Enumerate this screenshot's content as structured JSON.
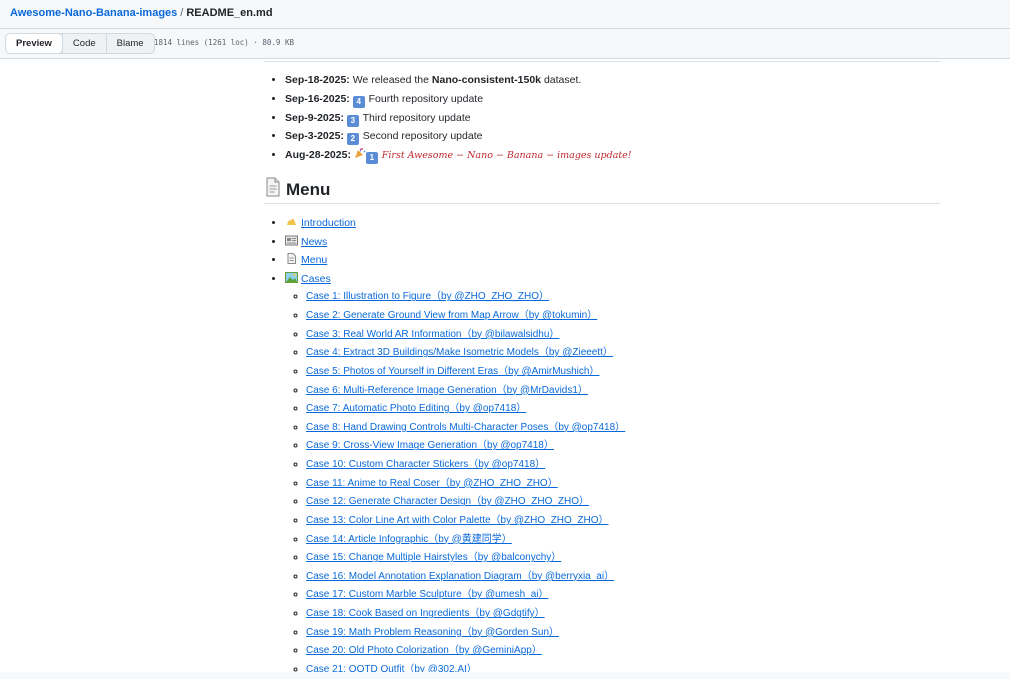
{
  "breadcrumb": {
    "repo": "Awesome-Nano-Banana-images",
    "separator": "/",
    "file": "README_en.md"
  },
  "toolbar": {
    "tabs": [
      {
        "label": "Preview",
        "active": true
      },
      {
        "label": "Code",
        "active": false
      },
      {
        "label": "Blame",
        "active": false
      }
    ],
    "file_info": "1814 lines (1261 loc) · 80.9 KB"
  },
  "news": [
    {
      "date": "Sep-18-2025:",
      "pre": " We released the ",
      "bold": "Nano-consistent-150k",
      "post": " dataset."
    },
    {
      "date": "Sep-16-2025:",
      "badge": "4",
      "text": "Fourth repository update"
    },
    {
      "date": "Sep-9-2025:",
      "badge": "3",
      "text": "Third repository update"
    },
    {
      "date": "Sep-3-2025:",
      "badge": "2",
      "text": "Second repository update"
    },
    {
      "date": "Aug-28-2025:",
      "badge": "1",
      "red_text": "First Awesome − Nano − Banana − images update!"
    }
  ],
  "menu": {
    "heading": "Menu",
    "items": [
      {
        "label": "Introduction",
        "icon": "wave-icon"
      },
      {
        "label": "News",
        "icon": "newspaper-icon"
      },
      {
        "label": "Menu",
        "icon": "document-icon"
      },
      {
        "label": "Cases",
        "icon": "picture-icon"
      }
    ],
    "cases": [
      "Case 1: Illustration to Figure（by @ZHO_ZHO_ZHO）",
      "Case 2: Generate Ground View from Map Arrow（by @tokumin）",
      "Case 3: Real World AR Information（by @bilawalsidhu）",
      "Case 4: Extract 3D Buildings/Make Isometric Models（by @Zieeett）",
      "Case 5: Photos of Yourself in Different Eras（by @AmirMushich）",
      "Case 6: Multi-Reference Image Generation（by @MrDavids1）",
      "Case 7: Automatic Photo Editing（by @op7418）",
      "Case 8: Hand Drawing Controls Multi-Character Poses（by @op7418）",
      "Case 9: Cross-View Image Generation（by @op7418）",
      "Case 10: Custom Character Stickers（by @op7418）",
      "Case 11: Anime to Real Coser（by @ZHO_ZHO_ZHO）",
      "Case 12: Generate Character Design（by @ZHO_ZHO_ZHO）",
      "Case 13: Color Line Art with Color Palette（by @ZHO_ZHO_ZHO）",
      "Case 14: Article Infographic（by @黄建同学）",
      "Case 15: Change Multiple Hairstyles（by @balconychy）",
      "Case 16: Model Annotation Explanation Diagram（by @berryxia_ai）",
      "Case 17: Custom Marble Sculpture（by @umesh_ai）",
      "Case 18: Cook Based on Ingredients（by @Gdgtify）",
      "Case 19: Math Problem Reasoning（by @Gorden Sun）",
      "Case 20: Old Photo Colorization（by @GeminiApp）",
      "Case 21: OOTD Outfit（by @302.AI）"
    ]
  }
}
